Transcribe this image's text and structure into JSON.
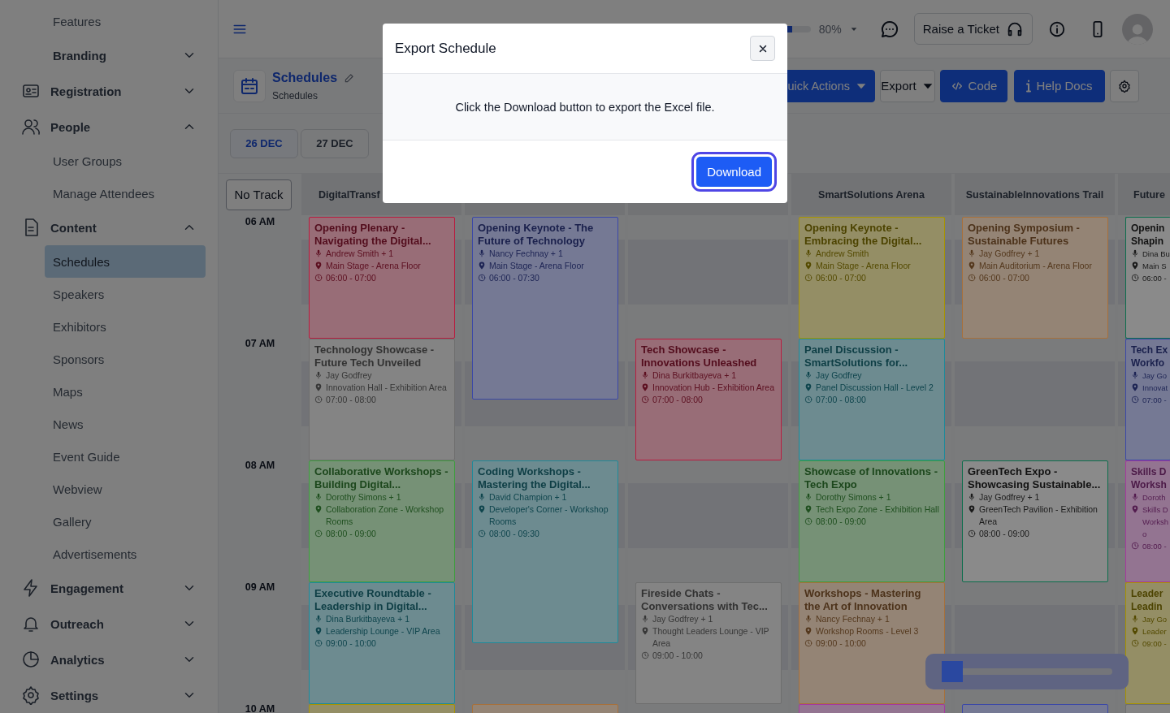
{
  "sidebar": {
    "items": [
      {
        "kind": "link",
        "label": "Features",
        "selected": false
      },
      {
        "kind": "subsection",
        "label": "Branding",
        "selected": false,
        "expanded": false
      },
      {
        "kind": "section",
        "label": "Registration",
        "selected": false,
        "expanded": false
      },
      {
        "kind": "section",
        "label": "People",
        "selected": false,
        "expanded": true,
        "children": [
          {
            "kind": "link",
            "label": "User Groups",
            "selected": false
          },
          {
            "kind": "link",
            "label": "Manage Attendees",
            "selected": false
          }
        ]
      },
      {
        "kind": "section",
        "label": "Content",
        "selected": false,
        "expanded": true,
        "children": [
          {
            "kind": "link",
            "label": "Schedules",
            "selected": true
          },
          {
            "kind": "link",
            "label": "Speakers",
            "selected": false
          },
          {
            "kind": "link",
            "label": "Exhibitors",
            "selected": false
          },
          {
            "kind": "link",
            "label": "Sponsors",
            "selected": false
          },
          {
            "kind": "link",
            "label": "Maps",
            "selected": false
          },
          {
            "kind": "link",
            "label": "News",
            "selected": false
          },
          {
            "kind": "link",
            "label": "Event Guide",
            "selected": false
          },
          {
            "kind": "link",
            "label": "Webview",
            "selected": false
          },
          {
            "kind": "link",
            "label": "Gallery",
            "selected": false
          },
          {
            "kind": "link",
            "label": "Advertisements",
            "selected": false
          }
        ]
      },
      {
        "kind": "section",
        "label": "Engagement",
        "selected": false,
        "expanded": false
      },
      {
        "kind": "section",
        "label": "Outreach",
        "selected": false,
        "expanded": false
      },
      {
        "kind": "section",
        "label": "Analytics",
        "selected": false,
        "expanded": false
      },
      {
        "kind": "section",
        "label": "Settings",
        "selected": false,
        "expanded": false
      }
    ]
  },
  "topbar": {
    "progress": {
      "level": 0.8,
      "reading": "80%"
    },
    "ticket_button": "Raise a Ticket"
  },
  "page_header": {
    "title": "Schedules",
    "subtitle": "Schedules",
    "actions": [
      {
        "kind": "primary-dropdown",
        "label": "uick Actions"
      },
      {
        "kind": "dropdown",
        "label": "Export"
      },
      {
        "kind": "code",
        "label": "Code"
      },
      {
        "kind": "help",
        "label": "Help Docs"
      },
      {
        "kind": "settings"
      }
    ]
  },
  "day_tabs": [
    {
      "label": "26 DEC",
      "selected": true
    },
    {
      "label": "27 DEC",
      "selected": false
    }
  ],
  "schedule": {
    "no_track_button": "No Track",
    "time_labels": [
      "06 AM",
      "07 AM",
      "08 AM",
      "09 AM",
      "10 AM"
    ],
    "tracks": [
      {
        "name": "DigitalTransf",
        "events": [
          {
            "kind": "filled",
            "color": "#b81d40",
            "title": "Opening Plenary - Navigating the Digital...",
            "speaker": "Andrew Smith + 1",
            "location": "Main Stage - Arena Floor",
            "time": "06:00 - 07:00"
          },
          {
            "kind": "filled",
            "color": "#6e6e6e",
            "title": "Technology Showcase - Future Tech Unveiled",
            "speaker": "Jay Godfrey",
            "location": "Innovation Hall - Exhibition Area",
            "time": "07:00 - 08:00"
          },
          {
            "kind": "filled",
            "color": "#3e9e3e",
            "title": "Collaborative Workshops - Building Digital...",
            "speaker": "Dorothy Simons + 1",
            "location": "Collaboration Zone - Workshop Rooms",
            "time": "08:00 - 09:00"
          },
          {
            "kind": "filled",
            "color": "#1e8a9a",
            "title": "Executive Roundtable - Leadership in Digital...",
            "speaker": "Dina Burkitbayeva + 1",
            "location": "Leadership Lounge - VIP Area",
            "time": "09:00 - 10:00"
          },
          {
            "kind": "cut",
            "color": "#a89400"
          }
        ]
      },
      {
        "events": [
          {
            "kind": "filled",
            "color": "#3a47a8",
            "title": "Opening Keynote - The Future of Technology",
            "speaker": "Nancy Fechnay + 1",
            "location": "Main Stage - Arena Floor",
            "time": "06:00 - 07:30"
          },
          {
            "kind": "filled",
            "color": "#1e8a9a",
            "title": "Coding Workshops - Mastering the Digital...",
            "speaker": "David Champion + 1",
            "location": "Developer's Corner - Workshop Rooms",
            "time": "08:00 - 09:30"
          },
          {
            "kind": "cut",
            "color": "#a8703a"
          }
        ]
      },
      {
        "events": [
          {
            "kind": "filled",
            "color": "#b81d40",
            "title": "Tech Showcase - Innovations Unleashed",
            "speaker": "Dina Burkitbayeva + 1",
            "location": "Innovation Hub - Exhibition Area",
            "time": "07:00 - 08:00"
          },
          {
            "kind": "filled",
            "color": "#6e6e6e",
            "title": "Fireside Chats - Conversations with Tec...",
            "speaker": "Jay Godfrey + 1",
            "location": "Thought Leaders Lounge - VIP Area",
            "time": "09:00 - 10:00"
          }
        ]
      },
      {
        "name": "SmartSolutions Arena",
        "events": [
          {
            "kind": "filled",
            "color": "#a89400",
            "title": "Opening Keynote - Embracing the Digital...",
            "speaker": "Andrew Smith",
            "location": "Main Stage - Arena Floor",
            "time": "06:00 - 07:00"
          },
          {
            "kind": "filled",
            "color": "#1e8a9a",
            "title": "Panel Discussion - SmartSolutions for...",
            "speaker": "Jay Godfrey",
            "location": "Panel Discussion Hall - Level 2",
            "time": "07:00 - 08:00"
          },
          {
            "kind": "filled",
            "color": "#3e9e3e",
            "title": "Showcase of Innovations - Tech Expo",
            "speaker": "Dorothy Simons + 1",
            "location": "Tech Expo Zone - Exhibition Hall",
            "time": "08:00 - 09:00"
          },
          {
            "kind": "filled",
            "color": "#a8703a",
            "title": "Workshops - Mastering the Art of Innovation",
            "speaker": "Nancy Fechnay + 1",
            "location": "Workshop Rooms - Level 3",
            "time": "09:00 - 10:00"
          },
          {
            "kind": "cut",
            "color": "#a6389e"
          }
        ]
      },
      {
        "name": "SustainableInnovations Trail",
        "events": [
          {
            "kind": "filled",
            "color": "#a8703a",
            "title": "Opening Symposium - Sustainable Futures",
            "speaker": "Jay Godfrey + 1",
            "location": "Main Auditorium - Arena Floor",
            "time": "06:00 - 07:00"
          },
          {
            "kind": "outline",
            "color": "#0b6e4c",
            "title": "GreenTech Expo - Showcasing Sustainable...",
            "speaker": "Jay Godfrey + 1",
            "location": "GreenTech Pavilion - Exhibition Area",
            "time": "08:00 - 09:00"
          },
          {
            "kind": "cut",
            "color": "#3a47a8"
          }
        ]
      },
      {
        "name": "Future",
        "events": [
          {
            "kind": "outline",
            "color": "#0b6e4c",
            "title": "Openin Shapin",
            "speaker": "Dina Bu",
            "location": "Main S",
            "time": "06:00 -"
          },
          {
            "kind": "filled",
            "color": "#3a47a8",
            "title": "Tech Ex Workfo",
            "speaker": "Jay Go",
            "location": "Innovat",
            "time": "07:00 -"
          },
          {
            "kind": "filled",
            "color": "#a6389e",
            "title": "Skills D Worksh",
            "speaker": "Doroth",
            "location": "Skills D Worksho",
            "time": "08:00 -"
          },
          {
            "kind": "filled",
            "color": "#a89400",
            "title": "Leader Leadin",
            "speaker": "Jay Go",
            "location": "Leader",
            "time": "09:00 -"
          },
          {
            "kind": "cut",
            "color": "#6e6e6e"
          }
        ]
      }
    ]
  },
  "modal": {
    "title": "Export Schedule",
    "message": "Click the Download button to export the Excel file.",
    "button": "Download"
  }
}
